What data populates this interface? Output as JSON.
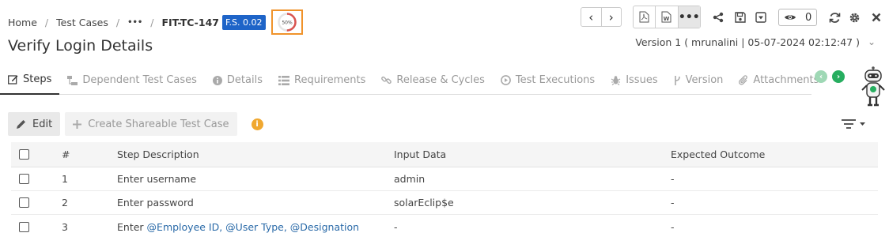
{
  "breadcrumb": {
    "home": "Home",
    "test_cases": "Test Cases",
    "ellipsis": "•••",
    "id": "FIT-TC-147",
    "badge": "F.S. 0.02",
    "progress_label": "50%",
    "progress_value": 0.5
  },
  "header": {
    "title": "Verify Login Details",
    "version_info": "Version 1 ( mrunalini | 05-07-2024 02:12:47 )",
    "watch_count": "0",
    "more_label": "•••"
  },
  "tabs": [
    {
      "label": "Steps",
      "icon": "edit-icon",
      "active": true
    },
    {
      "label": "Dependent Test Cases",
      "icon": "sitemap-icon",
      "active": false
    },
    {
      "label": "Details",
      "icon": "info-icon",
      "active": false
    },
    {
      "label": "Requirements",
      "icon": "list-icon",
      "active": false
    },
    {
      "label": "Release & Cycles",
      "icon": "link-icon",
      "active": false
    },
    {
      "label": "Test Executions",
      "icon": "play-circle-icon",
      "active": false
    },
    {
      "label": "Issues",
      "icon": "bug-icon",
      "active": false
    },
    {
      "label": "Version",
      "icon": "branch-icon",
      "active": false
    },
    {
      "label": "Attachments",
      "icon": "paperclip-icon",
      "active": false
    }
  ],
  "toolbar": {
    "edit": "Edit",
    "create_shareable": "Create Shareable Test Case"
  },
  "table": {
    "columns": {
      "num": "#",
      "desc": "Step Description",
      "input": "Input Data",
      "outcome": "Expected Outcome"
    },
    "rows": [
      {
        "num": "1",
        "desc": "Enter username",
        "input": "admin",
        "outcome": "-"
      },
      {
        "num": "2",
        "desc": "Enter password",
        "input": "solarEclip$e",
        "outcome": "-"
      },
      {
        "num": "3",
        "desc_prefix": "Enter",
        "desc_params": "@Employee ID, @User Type, @Designation",
        "input": "-",
        "outcome": "-"
      }
    ]
  },
  "colors": {
    "badge": "#1e64c8",
    "progress": "#d9534f",
    "highlight_border": "#f0932b",
    "tab_scroll_green": "#27ae60",
    "parameter_link": "#2a6aa8"
  }
}
